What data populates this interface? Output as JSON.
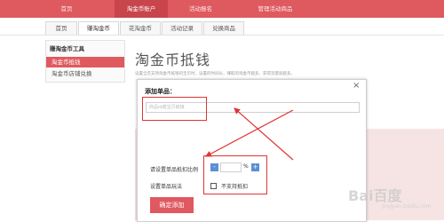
{
  "topnav": {
    "items": [
      {
        "label": "首页"
      },
      {
        "label": "淘金币账户"
      },
      {
        "label": "活动报名"
      },
      {
        "label": "管理活动商品"
      }
    ]
  },
  "subtabs": [
    {
      "label": "首页"
    },
    {
      "label": "赚淘金币"
    },
    {
      "label": "花淘金币"
    },
    {
      "label": "活动记录"
    },
    {
      "label": "兑换商品"
    }
  ],
  "sidebar": {
    "title": "赚淘金币工具",
    "items": [
      {
        "label": "淘金币抵钱"
      },
      {
        "label": "淘金币店铺兑换"
      }
    ]
  },
  "main": {
    "title": "淘金币抵钱",
    "desc_line1": "设置全店支持淘金币抵钱的宝贝时，设置的时间长，赚取的淘金币越多，获得流量就越多。",
    "desc_line2": ""
  },
  "modal": {
    "title": "添加单品：",
    "close_symbol": "×",
    "input_placeholder": "商品id或宝贝链接",
    "ratio_label": "请设置单品抵扣比例",
    "minus": "-",
    "percent": "%",
    "plus": "+",
    "play_label": "设置单品玩法",
    "checkbox_label": "不支持抵扣",
    "confirm_button": "确定添加"
  },
  "watermark": {
    "text": "Bai百度",
    "sub": "jingyan.baidu.com"
  },
  "colors": {
    "brand_red": "#de5a5f",
    "annotation_red": "#e03535",
    "stepper_blue": "#5a8fd6"
  }
}
